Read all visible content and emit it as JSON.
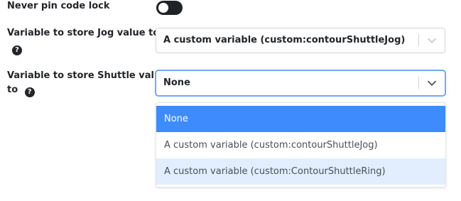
{
  "settings": {
    "never_pin": {
      "label": "Never pin code lock",
      "enabled": false
    },
    "jog": {
      "label": "Variable to store Jog value to",
      "help_icon": "?",
      "value": "A custom variable (custom:contourShuttleJog)"
    },
    "shuttle": {
      "label_line1": "Variable to store Shuttle value",
      "label_line2": "to",
      "help_icon": "?",
      "value": "None",
      "dropdown_open": true,
      "options": [
        {
          "label": "None",
          "state": "selected"
        },
        {
          "label": "A custom variable (custom:contourShuttleJog)",
          "state": "normal"
        },
        {
          "label": "A custom variable (custom:ContourShuttleRing)",
          "state": "hover"
        }
      ]
    }
  },
  "colors": {
    "toggle_off_track": "#1f2328",
    "focus_border": "#6ea8fe",
    "option_selected": "#3d8bfd",
    "option_hover": "#e2eefe"
  },
  "icons": {
    "help": "question-circle-icon",
    "chevron": "chevron-down-icon"
  }
}
